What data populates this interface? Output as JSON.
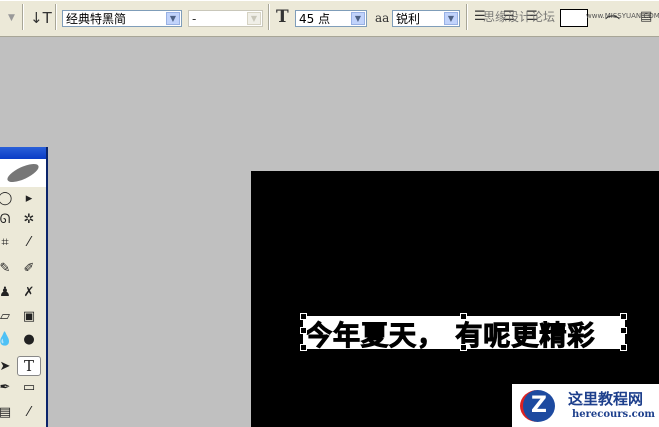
{
  "options_bar": {
    "font_family": "经典特黑简",
    "font_style": "-",
    "font_size": "45 点",
    "antialias": "锐利",
    "watermark_text": "思缘设计论坛",
    "watermark_url": "www.MISSYUAN.COM"
  },
  "canvas": {
    "text_layer": "今年夏天， 有呢更精彩"
  },
  "logo": {
    "name": "这里教程网",
    "url": "herecours.com",
    "mark": "Z"
  }
}
